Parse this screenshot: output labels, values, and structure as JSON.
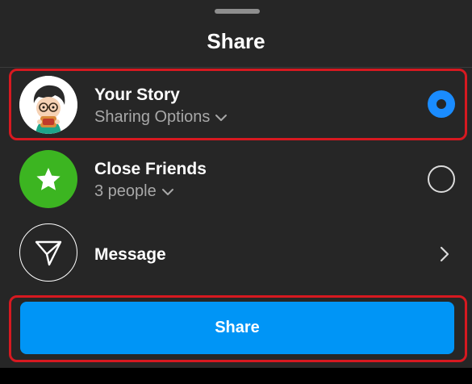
{
  "sheet": {
    "title": "Share"
  },
  "options": [
    {
      "label": "Your Story",
      "sublabel": "Sharing Options",
      "icon": "avatar-cartoon",
      "selected": true
    },
    {
      "label": "Close Friends",
      "sublabel": "3 people",
      "icon": "star-icon",
      "selected": false
    },
    {
      "label": "Message",
      "icon": "paper-plane-icon"
    }
  ],
  "share_button": {
    "label": "Share"
  },
  "colors": {
    "background": "#262626",
    "accent": "#0095f6",
    "radio_selected": "#1a8cff",
    "close_friends_green": "#3cb521",
    "highlight_red": "#d71920"
  }
}
